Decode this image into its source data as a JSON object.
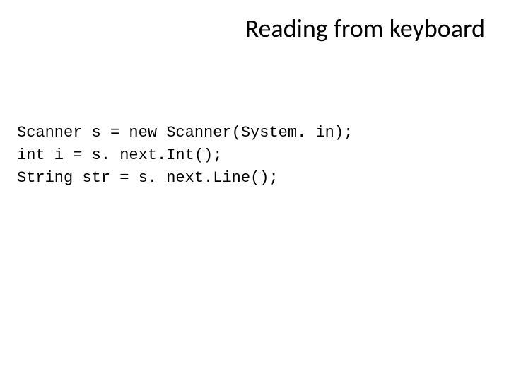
{
  "slide": {
    "title": "Reading from keyboard",
    "code": {
      "line1": "Scanner s = new Scanner(System. in);",
      "line2": "int i = s. next.Int();",
      "line3": "String str = s. next.Line();"
    }
  }
}
